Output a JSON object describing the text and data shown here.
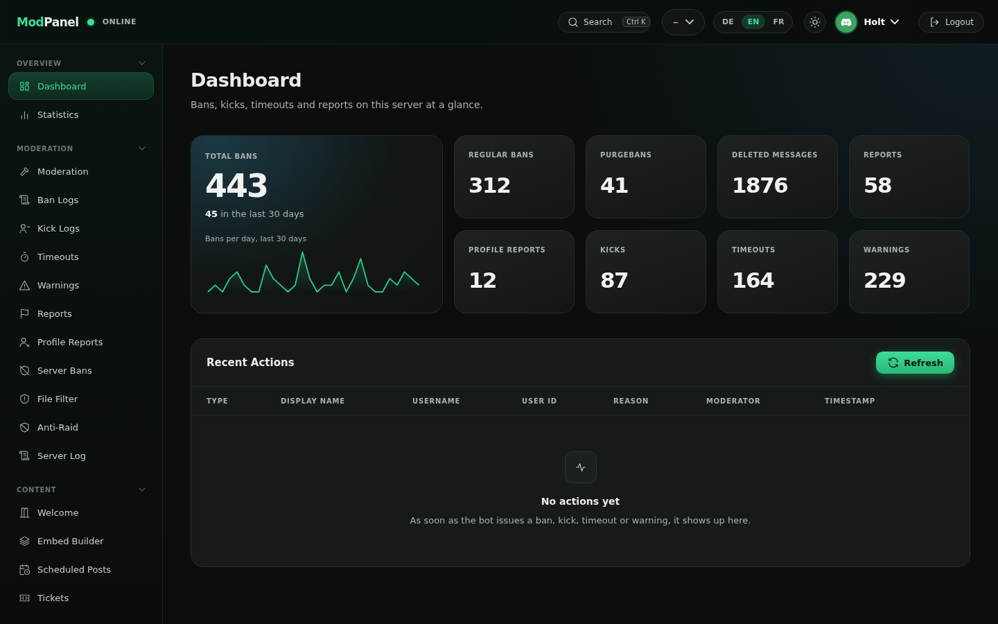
{
  "header": {
    "brand": {
      "accent": "Mod",
      "rest": "Panel"
    },
    "status": {
      "label": "ONLINE",
      "online": true
    },
    "search": {
      "placeholder": "Search",
      "shortcut": "Ctrl K"
    },
    "server_select": {
      "value": "–"
    },
    "languages": [
      {
        "label": "DE",
        "selected": false
      },
      {
        "label": "EN",
        "selected": true
      },
      {
        "label": "FR",
        "selected": false
      }
    ],
    "user": {
      "name": "Holt"
    },
    "logout": "Logout"
  },
  "sidebar": {
    "sections": [
      {
        "title": "OVERVIEW",
        "expanded": true,
        "items": [
          {
            "label": "Dashboard",
            "selected": true
          },
          {
            "label": "Statistics",
            "selected": false
          }
        ]
      },
      {
        "title": "MODERATION",
        "expanded": true,
        "items": [
          {
            "label": "Moderation",
            "selected": false
          },
          {
            "label": "Ban Logs",
            "selected": false
          },
          {
            "label": "Kick Logs",
            "selected": false
          },
          {
            "label": "Timeouts",
            "selected": false
          },
          {
            "label": "Warnings",
            "selected": false
          },
          {
            "label": "Reports",
            "selected": false
          },
          {
            "label": "Profile Reports",
            "selected": false
          },
          {
            "label": "Server Bans",
            "selected": false
          },
          {
            "label": "File Filter",
            "selected": false
          },
          {
            "label": "Anti-Raid",
            "selected": false
          },
          {
            "label": "Server Log",
            "selected": false
          }
        ]
      },
      {
        "title": "CONTENT",
        "expanded": true,
        "items": [
          {
            "label": "Welcome",
            "selected": false
          },
          {
            "label": "Embed Builder",
            "selected": false
          },
          {
            "label": "Scheduled Posts",
            "selected": false
          },
          {
            "label": "Tickets",
            "selected": false
          }
        ]
      }
    ]
  },
  "page": {
    "title": "Dashboard",
    "subtitle": "Bans, kicks, timeouts and reports on this server at a glance."
  },
  "total_bans": {
    "label": "TOTAL BANS",
    "value": "443",
    "note": "**45** in the last 30 days",
    "chart_caption": "Bans per day, last 30 days"
  },
  "stats": [
    {
      "label": "REGULAR BANS",
      "value": "312"
    },
    {
      "label": "PURGEBANS",
      "value": "41"
    },
    {
      "label": "DELETED MESSAGES",
      "value": "1876"
    },
    {
      "label": "REPORTS",
      "value": "58"
    },
    {
      "label": "PROFILE REPORTS",
      "value": "12"
    },
    {
      "label": "KICKS",
      "value": "87"
    },
    {
      "label": "TIMEOUTS",
      "value": "164"
    },
    {
      "label": "WARNINGS",
      "value": "229"
    }
  ],
  "recent_actions": {
    "title": "Recent Actions",
    "refresh": "Refresh",
    "columns": [
      "TYPE",
      "DISPLAY NAME",
      "USERNAME",
      "USER ID",
      "REASON",
      "MODERATOR",
      "TIMESTAMP"
    ],
    "empty": {
      "title": "No actions yet",
      "text": "As soon as the bot issues a ban, kick, timeout or warning, it shows up here."
    }
  }
}
